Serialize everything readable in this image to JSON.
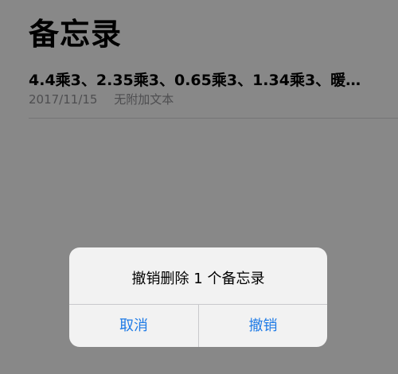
{
  "header": {
    "title": "备忘录"
  },
  "notes": [
    {
      "title": "4.4乘3、2.35乘3、0.65乘3、1.34乘3、暖…",
      "date": "2017/11/15",
      "preview": "无附加文本"
    }
  ],
  "alert": {
    "message": "撤销删除 1 个备忘录",
    "cancel_label": "取消",
    "confirm_label": "撤销"
  },
  "colors": {
    "accent": "#1f7be6",
    "overlay": "rgba(0,0,0,0.45)",
    "secondary_text": "#8e8e93"
  }
}
